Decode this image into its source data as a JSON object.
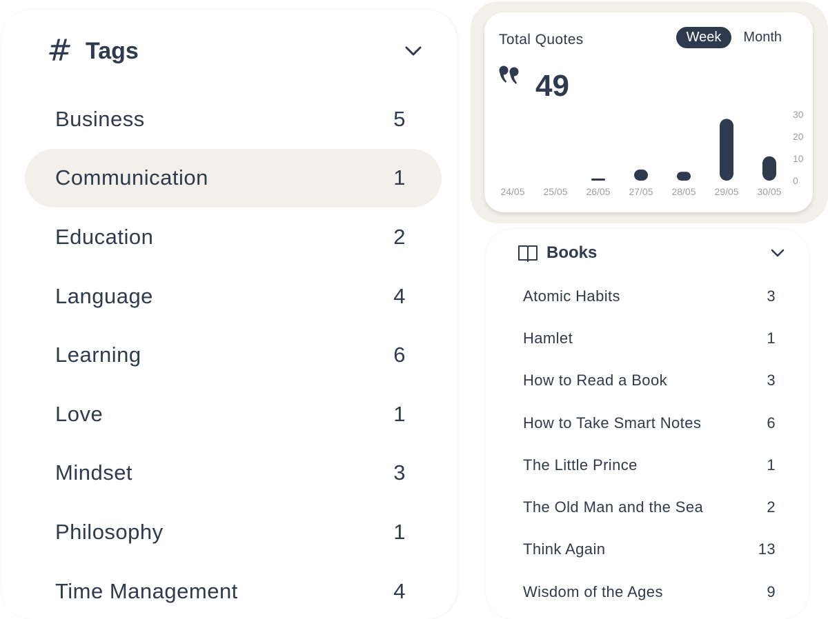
{
  "tags": {
    "icon": "hash-icon",
    "title": "Tags",
    "collapse_icon": "chevron-down-icon",
    "items": [
      {
        "label": "Business",
        "count": "5"
      },
      {
        "label": "Communication",
        "count": "1",
        "active": true
      },
      {
        "label": "Education",
        "count": "2"
      },
      {
        "label": "Language",
        "count": "4"
      },
      {
        "label": "Learning",
        "count": "6"
      },
      {
        "label": "Love",
        "count": "1"
      },
      {
        "label": "Mindset",
        "count": "3"
      },
      {
        "label": "Philosophy",
        "count": "1"
      },
      {
        "label": "Time Management",
        "count": "4"
      }
    ]
  },
  "stats": {
    "title": "Total Quotes",
    "toggle": {
      "week": "Week",
      "month": "Month",
      "selected": "Week"
    },
    "icon": "quote-icon",
    "total": "49"
  },
  "chart_data": {
    "type": "bar",
    "title": "Total Quotes",
    "categories": [
      "24/05",
      "25/05",
      "26/05",
      "27/05",
      "28/05",
      "29/05",
      "30/05"
    ],
    "values": [
      0,
      0,
      1,
      5,
      4,
      28,
      11
    ],
    "yticks": [
      "0",
      "10",
      "20",
      "30"
    ],
    "ylim": [
      0,
      30
    ],
    "xlabel": "",
    "ylabel": "",
    "grid": false,
    "y_axis_position": "right",
    "bar_color": "#2e3a4e"
  },
  "books": {
    "icon": "book-open-icon",
    "title": "Books",
    "collapse_icon": "chevron-down-icon",
    "items": [
      {
        "label": "Atomic Habits",
        "count": "3"
      },
      {
        "label": "Hamlet",
        "count": "1"
      },
      {
        "label": "How to Read a Book",
        "count": "3"
      },
      {
        "label": "How to Take Smart Notes",
        "count": "6"
      },
      {
        "label": "The Little Prince",
        "count": "1"
      },
      {
        "label": "The Old Man and the Sea",
        "count": "2"
      },
      {
        "label": "Think Again",
        "count": "13"
      },
      {
        "label": "Wisdom of the Ages",
        "count": "9"
      }
    ]
  },
  "colors": {
    "text": "#2e3a4e",
    "highlight": "#f3efea",
    "axis_text": "#9a9ea6"
  }
}
